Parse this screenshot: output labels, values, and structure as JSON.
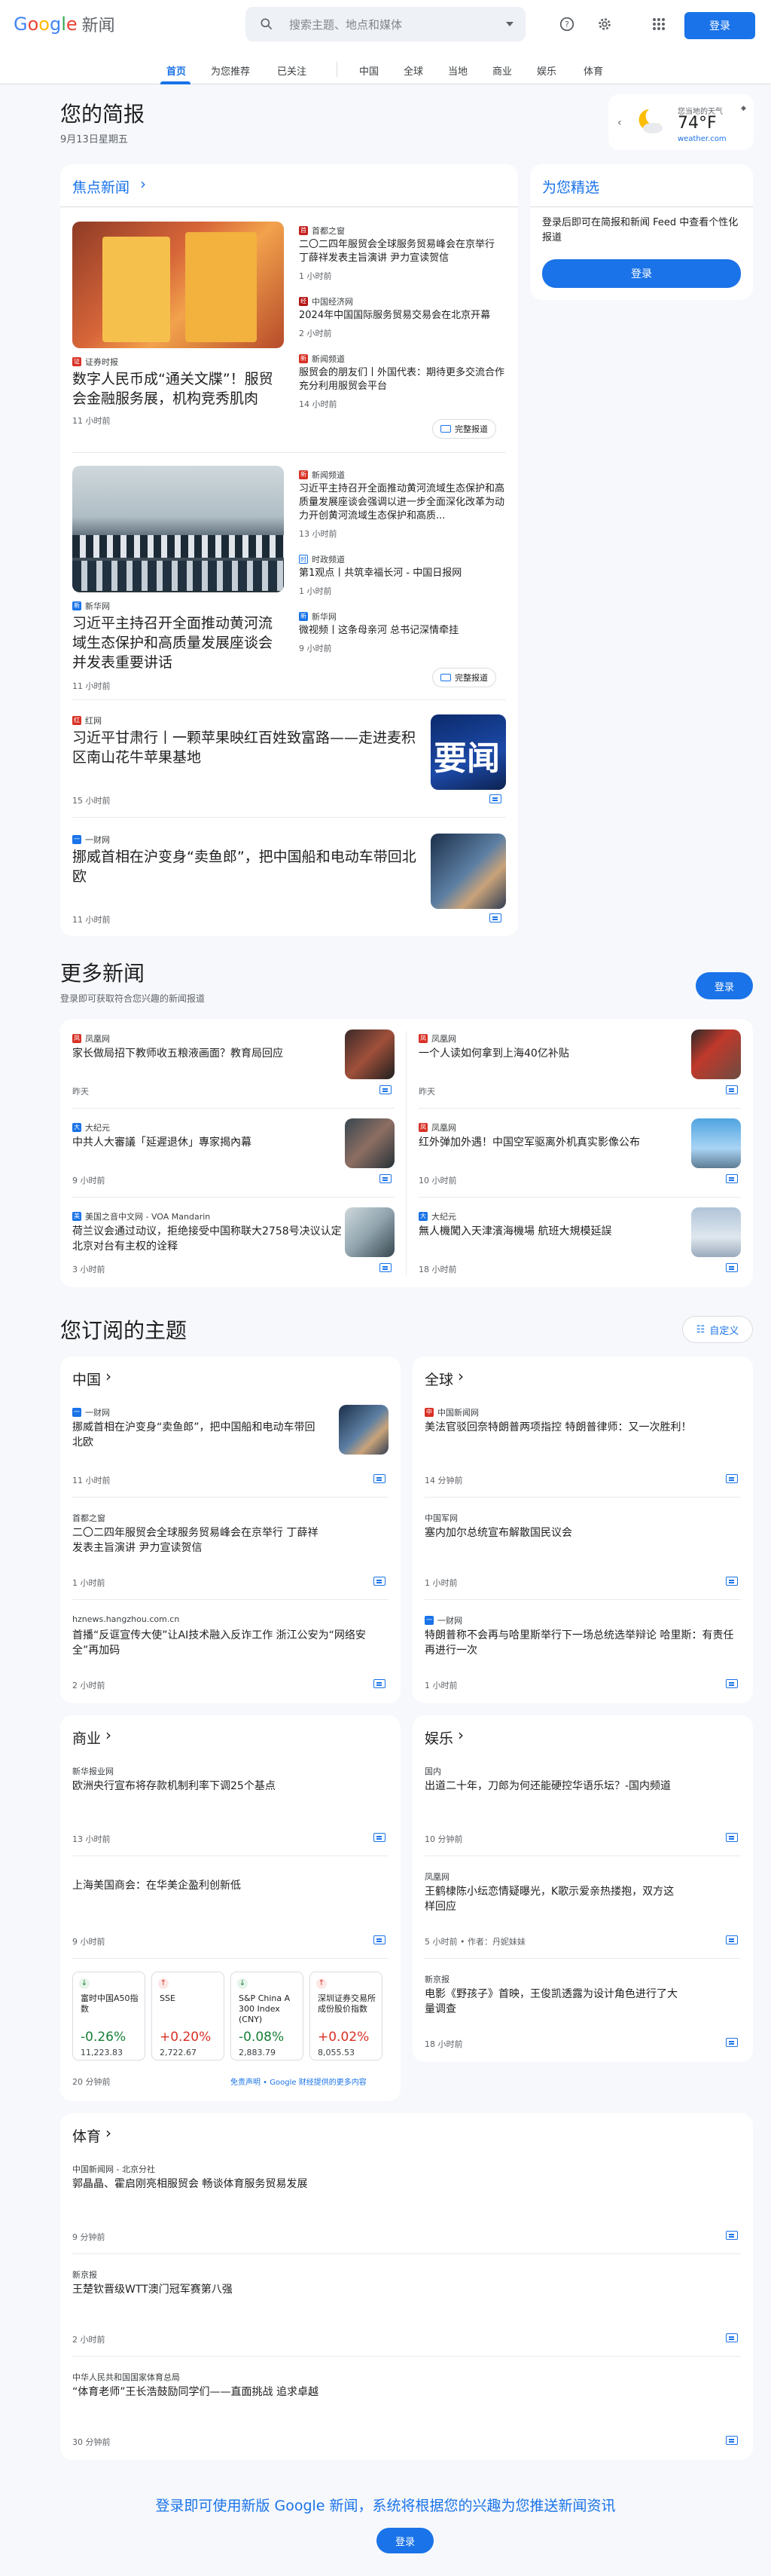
{
  "header": {
    "logo_text": "新闻",
    "search_placeholder": "搜索主题、地点和媒体",
    "signin": "登录"
  },
  "nav": {
    "items": [
      "首页",
      "为您推荐",
      "已关注",
      "中国",
      "全球",
      "当地",
      "商业",
      "娱乐",
      "体育"
    ]
  },
  "brief": {
    "title": "您的简报",
    "date": "9月13日星期五"
  },
  "weather": {
    "label": "您当地的天气",
    "temp": "74°F",
    "source": "weather.com"
  },
  "top_stories": {
    "heading": "焦点新闻",
    "full_coverage": "完整报道",
    "clusters": [
      {
        "main": {
          "source": "证券时报",
          "title": "数字人民币成“通关文牒”！服贸会金融服务展，机构竞秀肌肉",
          "time": "11 小时前"
        },
        "side": [
          {
            "source": "首都之窗",
            "title": "二〇二四年服贸会全球服务贸易峰会在京举行 丁薛祥发表主旨演讲 尹力宣读贺信",
            "time": "1 小时前"
          },
          {
            "source": "中国经济网",
            "title": "2024年中国国际服务贸易交易会在北京开幕",
            "time": "2 小时前"
          },
          {
            "source": "新闻频道",
            "title": "服贸会的朋友们丨外国代表：期待更多交流合作 充分利用服贸会平台",
            "time": "14 小时前"
          }
        ]
      },
      {
        "main": {
          "source": "新华网",
          "title": "习近平主持召开全面推动黄河流域生态保护和高质量发展座谈会并发表重要讲话",
          "time": "11 小时前"
        },
        "side": [
          {
            "source": "新闻频道",
            "title": "习近平主持召开全面推动黄河流域生态保护和高质量发展座谈会强调以进一步全面深化改革为动力开创黄河流域生态保护和高质...",
            "time": "13 小时前"
          },
          {
            "source": "时政频道",
            "title": "第1观点丨共筑幸福长河 - 中国日报网",
            "time": "1 小时前"
          },
          {
            "source": "新华网",
            "title": "微视频丨这条母亲河 总书记深情牵挂",
            "time": "9 小时前"
          }
        ]
      }
    ],
    "singles": [
      {
        "source": "红网",
        "title": "习近平甘肃行丨一颗苹果映红百姓致富路——走进麦积区南山花牛苹果基地",
        "time": "15 小时前",
        "thumb_text": "要闻"
      },
      {
        "source": "一财网",
        "title": "挪威首相在沪变身“卖鱼郎”，把中国船和电动车带回北欧",
        "time": "11 小时前"
      }
    ]
  },
  "picks": {
    "title": "为您精选",
    "text": "登录后即可在简报和新闻 Feed 中查看个性化报道",
    "button": "登录"
  },
  "more": {
    "title": "更多新闻",
    "subtitle": "登录即可获取符合您兴趣的新闻报道",
    "button": "登录",
    "items": [
      {
        "source": "凤凰网",
        "title": "家长做局招下教师收五粮液画面？教育局回应",
        "time": "昨天"
      },
      {
        "source": "凤凰网",
        "title": "一个人读如何拿到上海40亿补贴",
        "time": "昨天"
      },
      {
        "source": "大纪元",
        "title": "中共人大審議「延遲退休」專家揭內幕",
        "time": "9 小时前"
      },
      {
        "source": "凤凰网",
        "title": "红外弹加外遇！中国空军驱离外机真实影像公布",
        "time": "10 小时前"
      },
      {
        "source": "美国之音中文网 - VOA Mandarin",
        "title": "荷兰议会通过动议，拒绝接受中国称联大2758号决议认定北京对台有主权的诠释",
        "time": "3 小时前"
      },
      {
        "source": "大纪元",
        "title": "無人機闖入天津濱海機場 航班大規模延誤",
        "time": "18 小时前"
      }
    ]
  },
  "topics": {
    "title": "您订阅的主题",
    "customize": "自定义",
    "china": {
      "title": "中国",
      "items": [
        {
          "source": "一财网",
          "title": "挪威首相在沪变身“卖鱼郎”，把中国船和电动车带回北欧",
          "time": "11 小时前"
        },
        {
          "source": "首都之窗",
          "title": "二〇二四年服贸会全球服务贸易峰会在京举行 丁薛祥发表主旨演讲 尹力宣读贺信",
          "time": "1 小时前"
        },
        {
          "source": "hznews.hangzhou.com.cn",
          "title": "首播“反诓宣传大使”让AI技术融入反诈工作 浙江公安为“网络安全”再加码",
          "time": "2 小时前"
        }
      ]
    },
    "world": {
      "title": "全球",
      "items": [
        {
          "source": "中国新闻网",
          "title": "美法官驳回奈特朗普两项指控 特朗普律师：又一次胜利！",
          "time": "14 分钟前"
        },
        {
          "source": "中国军网",
          "title": "塞内加尔总统宣布解散国民议会",
          "time": "1 小时前"
        },
        {
          "source": "一财网",
          "title": "特朗普称不会再与哈里斯举行下一场总统选举辩论 哈里斯：有责任再进行一次",
          "time": "1 小时前"
        }
      ]
    },
    "business": {
      "title": "商业",
      "items": [
        {
          "source": "新华报业网",
          "title": "欧洲央行宣布将存款机制利率下调25个基点",
          "time": "13 小时前"
        },
        {
          "source": "",
          "title": "上海美国商会：在华美企盈利创新低",
          "time": "9 小时前"
        }
      ],
      "stocks": [
        {
          "name": "富时中国A50指数",
          "change": "-0.26%",
          "value": "11,223.83",
          "dir": "down"
        },
        {
          "name": "SSE",
          "change": "+0.20%",
          "value": "2,722.67",
          "dir": "up"
        },
        {
          "name": "S&P China A 300 Index (CNY)",
          "change": "-0.08%",
          "value": "2,883.79",
          "dir": "down"
        },
        {
          "name": "深圳证券交易所成份股价指数",
          "change": "+0.02%",
          "value": "8,055.53",
          "dir": "up"
        }
      ],
      "time": "20 分钟前",
      "disclaimer": "免责声明 • Google 财经提供的更多内容"
    },
    "ent": {
      "title": "娱乐",
      "items": [
        {
          "source": "国内",
          "title": "出道二十年，刀郎为何还能硬控华语乐坛？-国内频道",
          "time": "10 分钟前"
        },
        {
          "source": "凤凰网",
          "title": "王鹤棣陈小纭恋情疑曝光，K歌示爱亲热搂抱，双方这样回应",
          "time": "5 小时前 • 作者：丹妮妹妹"
        },
        {
          "source": "新京报",
          "title": "电影《野孩子》首映，王俊凯透露为设计角色进行了大量调查",
          "time": "18 小时前"
        }
      ]
    },
    "sports": {
      "title": "体育",
      "items": [
        {
          "source": "中国新闻网 - 北京分社",
          "title": "郭晶晶、霍启刚亮相服贸会 畅谈体育服务贸易发展",
          "time": "9 分钟前"
        },
        {
          "source": "新京报",
          "title": "王楚钦晋级WTT澳门冠军赛第八强",
          "time": "2 小时前"
        },
        {
          "source": "中华人民共和国国家体育总局",
          "title": "“体育老师”王长浩鼓励同学们——直面挑战 追求卓越",
          "time": "30 分钟前"
        }
      ]
    }
  },
  "footer": {
    "text": "登录即可使用新版 Google 新闻，系统将根据您的兴趣为您推送新闻资讯",
    "button": "登录"
  }
}
